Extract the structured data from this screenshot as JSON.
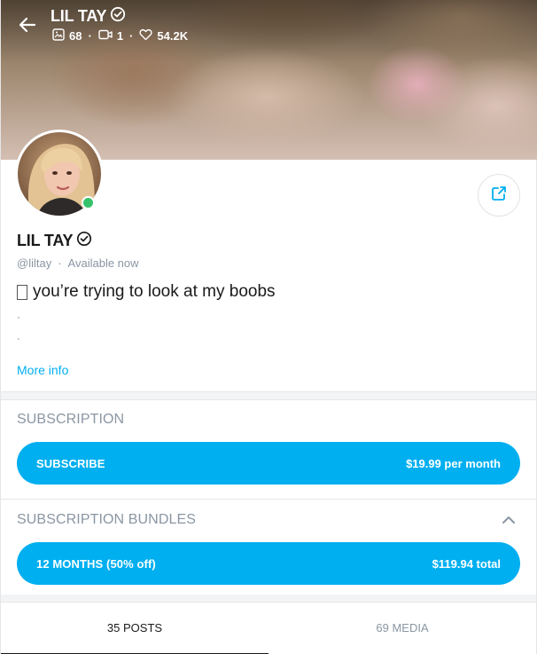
{
  "cover": {
    "name": "LIL TAY",
    "stats": {
      "photos": "68",
      "videos": "1",
      "likes": "54.2K"
    }
  },
  "profile": {
    "name": "LIL TAY",
    "handle": "@liltay",
    "status": "Available now",
    "bio": "you’re trying to look at my boobs",
    "more_info": "More info"
  },
  "subscription": {
    "title": "SUBSCRIPTION",
    "button_label": "SUBSCRIBE",
    "price": "$19.99 per month"
  },
  "bundles": {
    "title": "SUBSCRIPTION BUNDLES",
    "items": [
      {
        "label": "12 MONTHS (50% off)",
        "price": "$119.94 total"
      }
    ]
  },
  "tabs": [
    {
      "label": "35 POSTS",
      "active": true
    },
    {
      "label": "69 MEDIA",
      "active": false
    }
  ],
  "colors": {
    "accent": "#00aff0",
    "online": "#35c26b",
    "muted": "#8a96a3"
  }
}
